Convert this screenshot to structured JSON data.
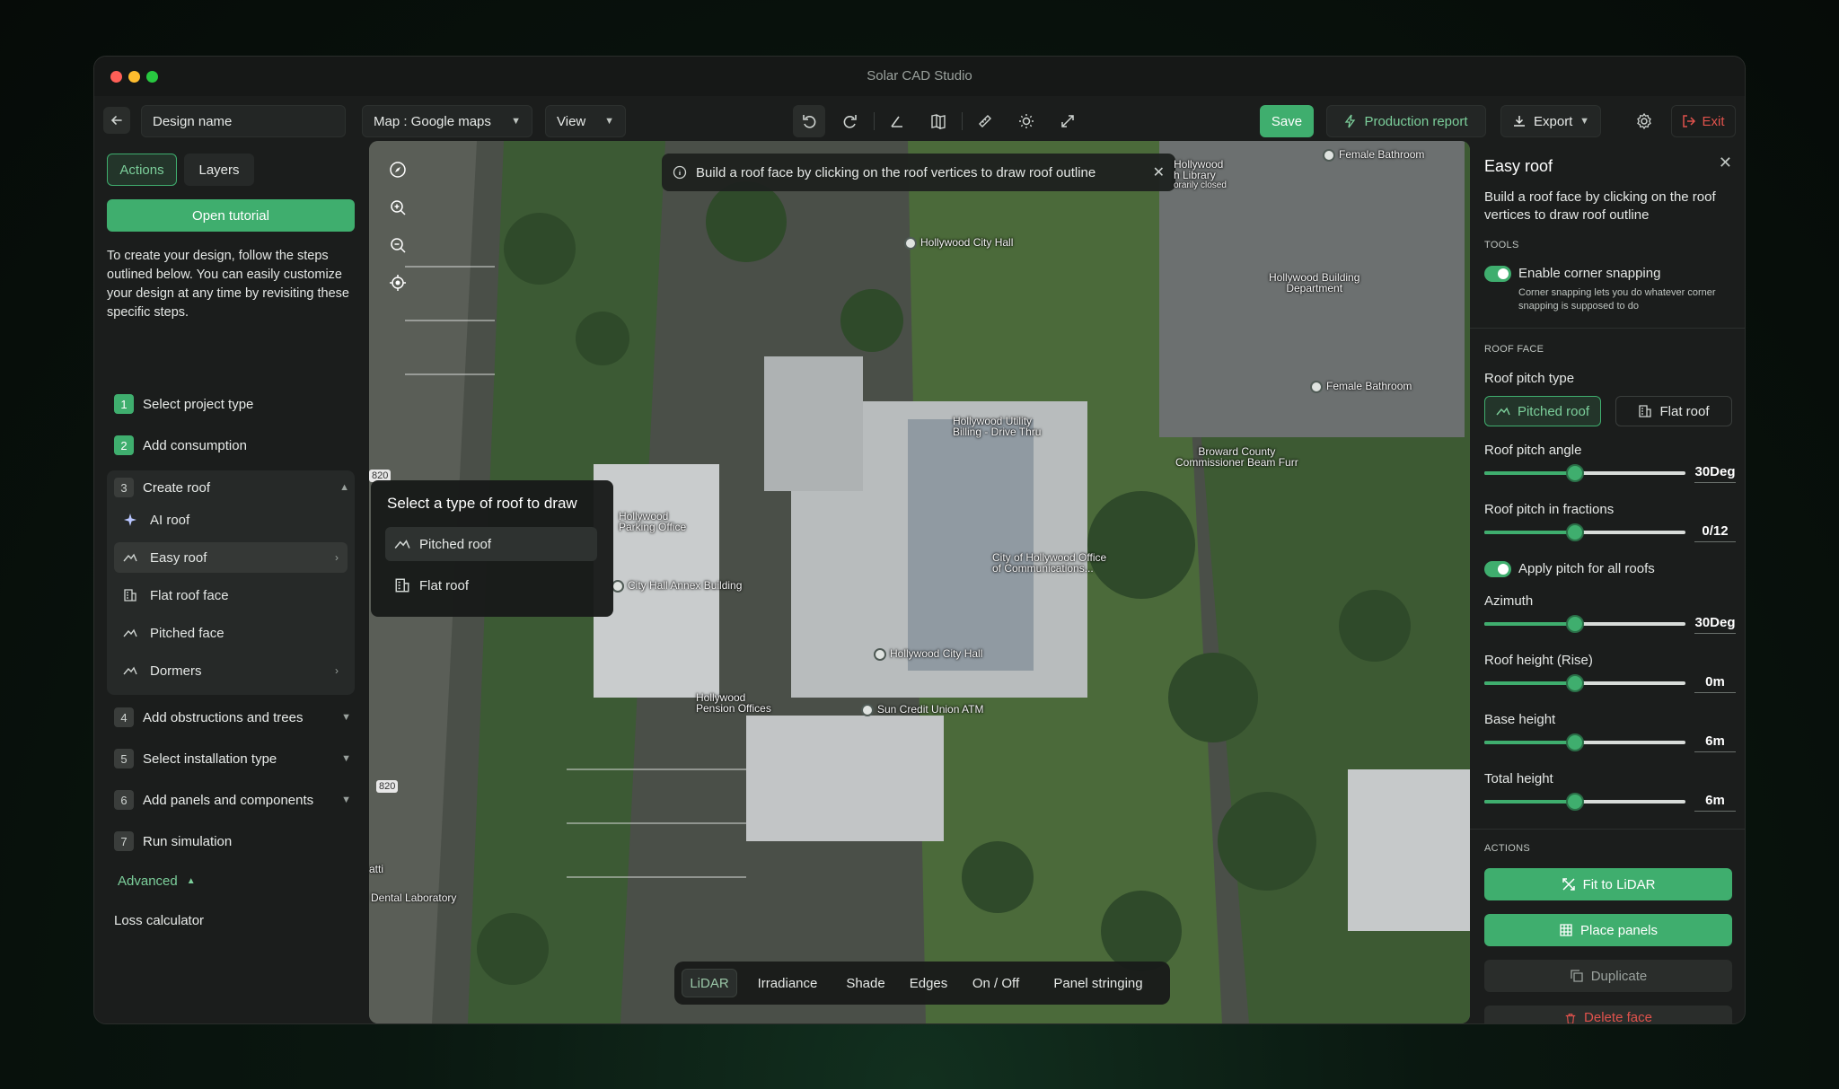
{
  "app": {
    "title": "Solar CAD Studio"
  },
  "toolbar": {
    "design_name": "Design name",
    "map_select": "Map : Google maps",
    "view_select": "View",
    "save": "Save",
    "production_report": "Production report",
    "export": "Export",
    "exit": "Exit"
  },
  "left": {
    "tabs": [
      "Actions",
      "Layers"
    ],
    "open_tutorial": "Open tutorial",
    "intro": "To create your design, follow the steps outlined below. You can easily customize your design at any time by revisiting these specific steps.",
    "steps": [
      {
        "num": "1",
        "label": "Select project type"
      },
      {
        "num": "2",
        "label": "Add consumption"
      },
      {
        "num": "3",
        "label": "Create roof"
      },
      {
        "num": "4",
        "label": "Add obstructions and trees"
      },
      {
        "num": "5",
        "label": "Select installation type"
      },
      {
        "num": "6",
        "label": "Add panels and components"
      },
      {
        "num": "7",
        "label": "Run simulation"
      }
    ],
    "roof_items": [
      "AI roof",
      "Easy roof",
      "Flat roof face",
      "Pitched face",
      "Dormers"
    ],
    "advanced": "Advanced",
    "loss_calculator": "Loss calculator"
  },
  "map": {
    "notice": "Build a roof face by clicking on the roof vertices to draw roof outline",
    "popup": {
      "title": "Select a type of roof to draw",
      "options": [
        "Pitched roof",
        "Flat roof"
      ]
    },
    "labels": {
      "hollywood_library": "Hollywood\nh Library",
      "temp_closed": "orarily closed",
      "female_bathroom_1": "Female Bathroom",
      "female_bathroom_2": "Female Bathroom",
      "city_hall_top": "Hollywood City Hall",
      "building_dept": "Hollywood Building\nDepartment",
      "utility_billing": "Hollywood Utility\nBilling - Drive Thru",
      "broward": "Broward County\nCommissioner Beam Furr",
      "parking_office": "Hollywood\nParking Office",
      "annex": "City Hall Annex Building",
      "office_comm": "City of Hollywood Office\nof Communications...",
      "city_hall_main": "Hollywood City Hall",
      "pension": "Hollywood\nPension Offices",
      "sun_credit": "Sun Credit Union ATM",
      "dental": "Dental Laboratory",
      "atti": "atti",
      "road_820a": "820",
      "road_820b": "820"
    },
    "bottom_tabs": [
      "LiDAR",
      "Irradiance",
      "Shade",
      "Edges",
      "On / Off",
      "Panel stringing"
    ]
  },
  "right": {
    "title": "Easy roof",
    "description": "Build a roof face by clicking on the roof vertices to draw roof outline",
    "tools_heading": "TOOLS",
    "corner_snapping": "Enable corner snapping",
    "corner_snapping_desc": "Corner snapping lets you do whatever corner snapping is supposed to do",
    "roof_face_heading": "ROOF FACE",
    "pitch_type_label": "Roof pitch type",
    "pitch_types": [
      "Pitched roof",
      "Flat roof"
    ],
    "sliders": [
      {
        "label": "Roof pitch angle",
        "value": "30Deg",
        "level": 0.45
      },
      {
        "label": "Roof pitch in fractions",
        "value": "0/12",
        "level": 0.45
      },
      {
        "label": "Azimuth",
        "value": "30Deg",
        "level": 0.45
      },
      {
        "label": "Roof height (Rise)",
        "value": "0m",
        "level": 0.45
      },
      {
        "label": "Base height",
        "value": "6m",
        "level": 0.45
      },
      {
        "label": "Total height",
        "value": "6m",
        "level": 0.45
      }
    ],
    "apply_pitch": "Apply pitch for all roofs",
    "actions_heading": "ACTIONS",
    "actions": [
      "Fit to LiDAR",
      "Place panels",
      "Duplicate",
      "Delete face"
    ]
  },
  "colors": {
    "accent": "#3fae6e",
    "danger": "#e0524c",
    "panel_bg": "#1b1d1c"
  }
}
